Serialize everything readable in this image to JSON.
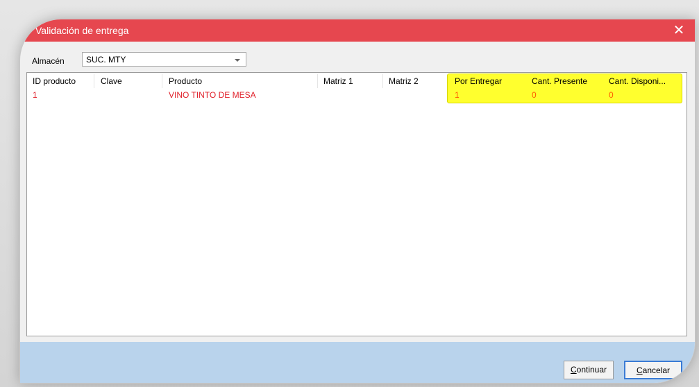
{
  "window": {
    "title": "Validación de entrega",
    "close_glyph": "✕"
  },
  "filter": {
    "almacen_label": "Almacén",
    "almacen_value": "SUC. MTY"
  },
  "table": {
    "columns": [
      "ID producto",
      "Clave",
      "Producto",
      "Matriz 1",
      "Matriz 2",
      "Por Entregar",
      "Cant. Presente",
      "Cant. Disponi..."
    ],
    "rows": [
      [
        "1",
        "",
        "VINO TINTO DE MESA",
        "",
        "",
        "1",
        "0",
        "0"
      ]
    ]
  },
  "buttons": {
    "continuar_prefix": "C",
    "continuar_rest": "ontinuar",
    "cancelar_prefix": "C",
    "cancelar_rest": "ancelar"
  },
  "colors": {
    "titlebar": "#e6474f",
    "row_text": "#e0202a",
    "highlight": "#ffff2e",
    "highlight_text": "#ff5a00",
    "footer": "#b9d3ec"
  }
}
